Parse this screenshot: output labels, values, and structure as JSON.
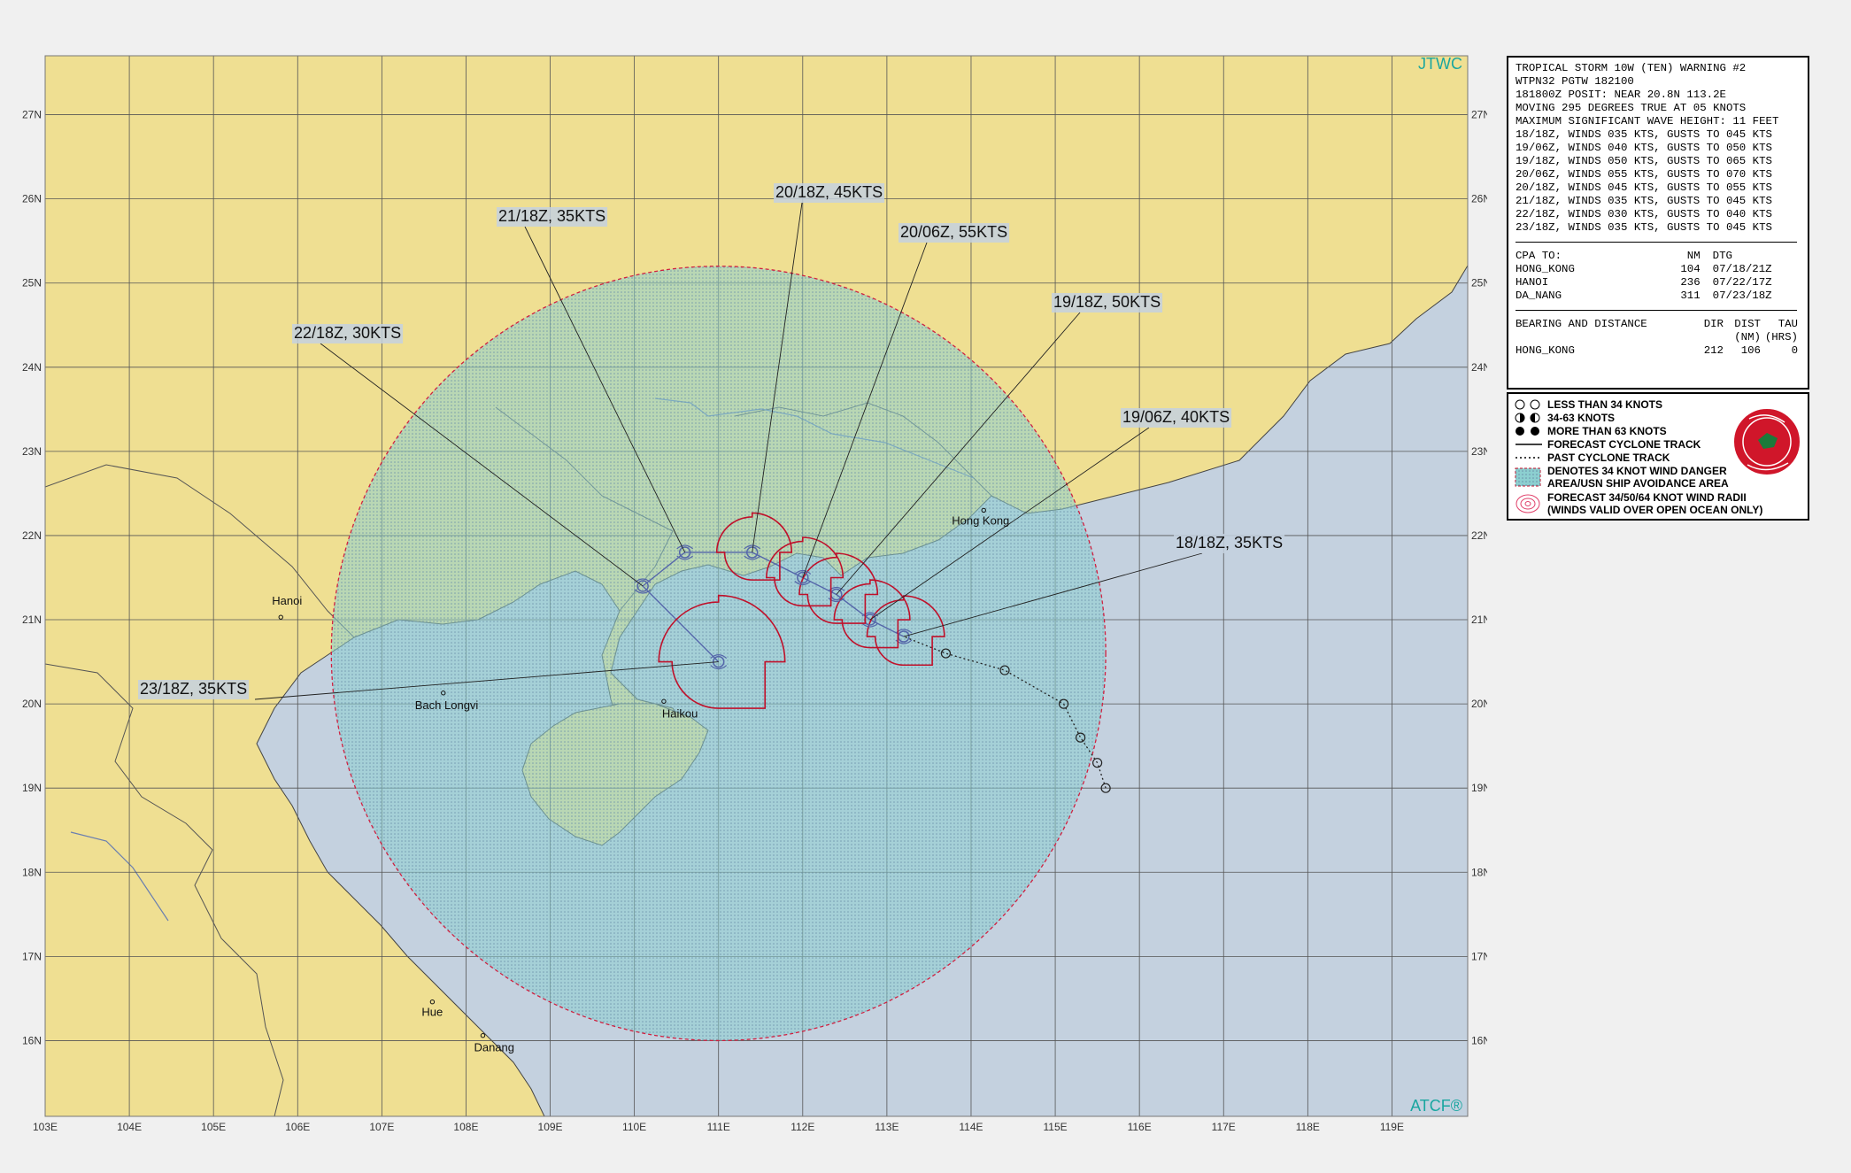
{
  "map": {
    "top_right_label": "JTWC",
    "bottom_right_label": "ATCF®",
    "lat_labels": [
      "27N",
      "26N",
      "25N",
      "24N",
      "23N",
      "22N",
      "21N",
      "20N",
      "19N",
      "18N",
      "17N",
      "16N"
    ],
    "lon_labels": [
      "103E",
      "104E",
      "105E",
      "106E",
      "107E",
      "108E",
      "109E",
      "110E",
      "111E",
      "112E",
      "113E",
      "114E",
      "115E",
      "116E",
      "117E",
      "118E",
      "119E"
    ],
    "cities": [
      {
        "name": "Hanoi",
        "lon": 105.8,
        "lat": 21.03
      },
      {
        "name": "Bach Longvi",
        "lon": 107.73,
        "lat": 20.13
      },
      {
        "name": "Haikou",
        "lon": 110.35,
        "lat": 20.03
      },
      {
        "name": "Hong Kong",
        "lon": 114.15,
        "lat": 22.3
      },
      {
        "name": "Hue",
        "lon": 107.6,
        "lat": 16.46
      },
      {
        "name": "Danang",
        "lon": 108.2,
        "lat": 16.06
      }
    ],
    "forecast_points": [
      {
        "label": "18/18Z, 35KTS",
        "lon": 113.2,
        "lat": 20.8
      },
      {
        "label": "19/06Z, 40KTS",
        "lon": 112.8,
        "lat": 21.0
      },
      {
        "label": "19/18Z, 50KTS",
        "lon": 112.4,
        "lat": 21.3
      },
      {
        "label": "20/06Z, 55KTS",
        "lon": 112.0,
        "lat": 21.5
      },
      {
        "label": "20/18Z, 45KTS",
        "lon": 111.4,
        "lat": 21.8
      },
      {
        "label": "21/18Z, 35KTS",
        "lon": 110.6,
        "lat": 21.8
      },
      {
        "label": "22/18Z, 30KTS",
        "lon": 110.1,
        "lat": 21.4
      },
      {
        "label": "23/18Z, 35KTS",
        "lon": 111.0,
        "lat": 20.5
      }
    ],
    "past_track": [
      {
        "lon": 115.6,
        "lat": 19.0
      },
      {
        "lon": 115.5,
        "lat": 19.3
      },
      {
        "lon": 115.3,
        "lat": 19.6
      },
      {
        "lon": 115.1,
        "lat": 20.0
      },
      {
        "lon": 114.4,
        "lat": 20.4
      },
      {
        "lon": 113.7,
        "lat": 20.6
      },
      {
        "lon": 113.2,
        "lat": 20.8
      }
    ],
    "danger_area": {
      "center_lon": 111.0,
      "center_lat": 20.6,
      "radius_deg": 4.6
    },
    "colors": {
      "land": "#efdf92",
      "sea": "#c4d1df",
      "danger": "#8ccfd0",
      "radii": "#c0102a",
      "track": "#5566aa",
      "border": "#555555"
    }
  },
  "info": {
    "header_lines": [
      "TROPICAL STORM 10W (TEN) WARNING #2",
      "WTPN32 PGTW 182100",
      "181800Z POSIT: NEAR 20.8N 113.2E",
      "MOVING 295 DEGREES TRUE AT 05 KNOTS",
      "MAXIMUM SIGNIFICANT WAVE HEIGHT: 11 FEET"
    ],
    "wind_lines": [
      "18/18Z, WINDS 035 KTS, GUSTS TO 045 KTS",
      "19/06Z, WINDS 040 KTS, GUSTS TO 050 KTS",
      "19/18Z, WINDS 050 KTS, GUSTS TO 065 KTS",
      "20/06Z, WINDS 055 KTS, GUSTS TO 070 KTS",
      "20/18Z, WINDS 045 KTS, GUSTS TO 055 KTS",
      "21/18Z, WINDS 035 KTS, GUSTS TO 045 KTS",
      "22/18Z, WINDS 030 KTS, GUSTS TO 040 KTS",
      "23/18Z, WINDS 035 KTS, GUSTS TO 045 KTS"
    ],
    "cpa": {
      "title": "CPA TO:",
      "nm_header": "NM",
      "dtg_header": "DTG",
      "rows": [
        {
          "place": "HONG_KONG",
          "nm": "104",
          "dtg": "07/18/21Z"
        },
        {
          "place": "HANOI",
          "nm": "236",
          "dtg": "07/22/17Z"
        },
        {
          "place": "DA_NANG",
          "nm": "311",
          "dtg": "07/23/18Z"
        }
      ]
    },
    "bearing": {
      "title": "BEARING AND DISTANCE",
      "dir_header": "DIR",
      "dist_header": "DIST",
      "tau_header": "TAU",
      "nm_sub": "(NM)",
      "hrs_sub": "(HRS)",
      "rows": [
        {
          "place": "HONG_KONG",
          "dir": "212",
          "dist": "106",
          "tau": "0"
        }
      ]
    }
  },
  "legend": {
    "items": [
      "LESS THAN 34 KNOTS",
      "34-63 KNOTS",
      "MORE THAN 63 KNOTS",
      "FORECAST CYCLONE TRACK",
      "PAST CYCLONE TRACK",
      "DENOTES 34 KNOT WIND DANGER",
      "AREA/USN SHIP AVOIDANCE AREA",
      "FORECAST 34/50/64 KNOT WIND RADII",
      "(WINDS VALID OVER OPEN OCEAN ONLY)"
    ]
  }
}
